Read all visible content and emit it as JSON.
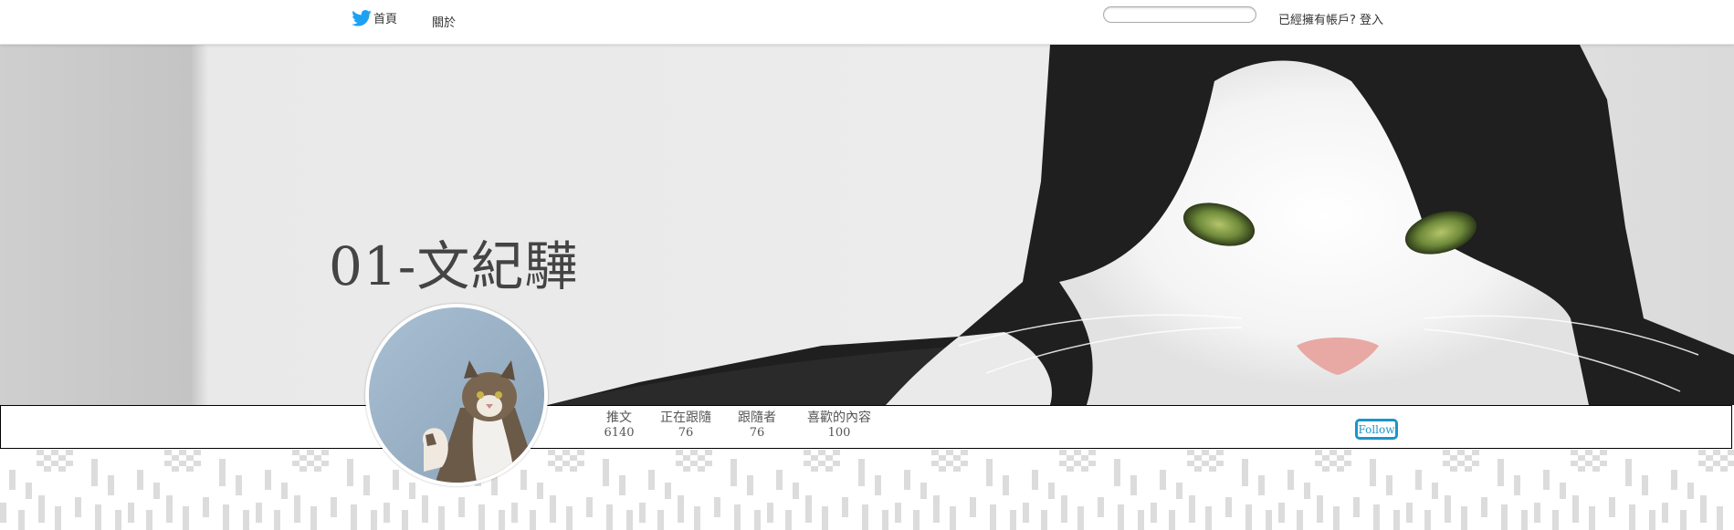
{
  "nav": {
    "home_label": "首頁",
    "about_label": "關於",
    "search_placeholder": "",
    "login_label": "已經擁有帳戶? 登入"
  },
  "profile": {
    "name": "01-文紀驊"
  },
  "stats": [
    {
      "label": "推文",
      "value": "6140"
    },
    {
      "label": "正在跟隨",
      "value": "76"
    },
    {
      "label": "跟隨者",
      "value": "76"
    },
    {
      "label": "喜歡的內容",
      "value": "100"
    }
  ],
  "actions": {
    "follow_label": "Follow"
  },
  "colors": {
    "accent": "#1b95c9",
    "twitter_blue": "#1da1f2"
  },
  "icons": [
    "twitter-bird-icon"
  ]
}
